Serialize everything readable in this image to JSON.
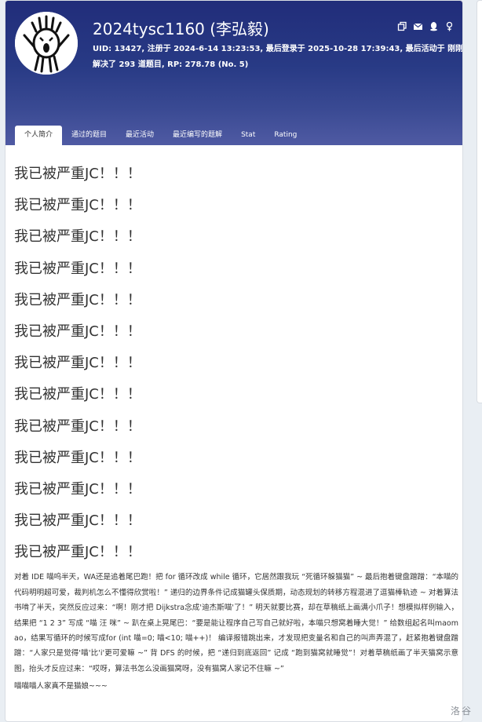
{
  "profile": {
    "username": "2024tysc1160",
    "realname": "(李弘毅)",
    "meta_line1": "UID: 13427, 注册于 2024-6-14 13:23:53, 最后登录于 2025-10-28 17:39:43, 最后活动于 刚刚.",
    "meta_line2": "解决了 293 道题目, RP: 278.78 (No. 5)"
  },
  "header_icons": [
    "copy-icon",
    "mail-icon",
    "qq-icon",
    "gender-icon"
  ],
  "tabs": [
    {
      "label": "个人简介",
      "active": true
    },
    {
      "label": "通过的题目",
      "active": false
    },
    {
      "label": "最近活动",
      "active": false
    },
    {
      "label": "最近编写的题解",
      "active": false
    },
    {
      "label": "Stat",
      "active": false
    },
    {
      "label": "Rating",
      "active": false
    }
  ],
  "intro": {
    "repeated_line": "我已被严重JC！！！",
    "repeat_count": 13,
    "story": "对着 IDE 喵呜半天，WA还是追着尾巴跑！把 for 循环改成 while 循环，它居然跟我玩 “死循环躲猫猫” ~ 最后抱着键盘蹭蹭：“本喵的代码明明超可爱，裁判机怎么不懂得欣赏啦！” 递归的边界条件记成猫罐头保质期，动态规划的转移方程混进了逗猫棒轨迹 ~ 对着算法书啃了半天，突然反应过来：“啊！刚才把 Dijkstra念成'迪杰斯喵'了！” 明天就要比赛，却在草稿纸上画满小爪子！想模拟样例输入，结果把 “1 2 3” 写成 “喵 汪 咪” ~ 趴在桌上晃尾巴：“要是能让程序自己写自己就好啦，本喵只想窝着睡大觉！” 给数组起名叫maomao，结果写循环的时候写成for (int 喵=0; 喵<10; 喵++)！ 编译报错跳出来，才发现把变量名和自己的叫声弄混了，赶紧抱着键盘蹭蹭：“人家只是觉得'喵'比'i'更可爱嘛 ~” 背 DFS 的时候，把 “递归到底返回” 记成 “跑到猫窝就睡觉”！对着草稿纸画了半天猫窝示意图，抬头才反应过来：“哎呀，算法书怎么没画猫窝呀，没有猫窝人家记不住嘛 ~”",
    "last_line": "喵喵喵人家真不是猫娘~~~"
  },
  "watermark": "洛谷"
}
